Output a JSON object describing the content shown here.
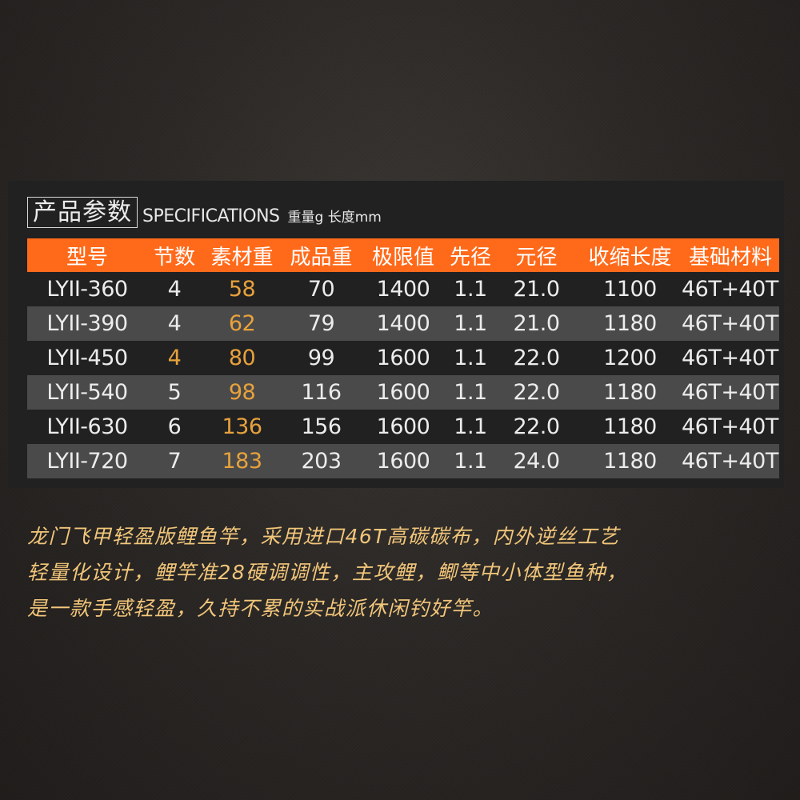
{
  "specs": {
    "title_cn": "产品参数",
    "title_en": "SPECIFICATIONS",
    "units": "重量g 长度mm",
    "headers": [
      "型号",
      "节数",
      "素材重",
      "成品重",
      "极限值",
      "先径",
      "元径",
      "收缩长度",
      "基础材料"
    ],
    "rows": [
      {
        "model": "LYII-360",
        "sections": "4",
        "raw_weight": "58",
        "finished_weight": "70",
        "limit": "1400",
        "tip_dia": "1.1",
        "base_dia": "21.0",
        "retracted_length": "1100",
        "material": "46T+40T"
      },
      {
        "model": "LYII-390",
        "sections": "4",
        "raw_weight": "62",
        "finished_weight": "79",
        "limit": "1400",
        "tip_dia": "1.1",
        "base_dia": "21.0",
        "retracted_length": "1180",
        "material": "46T+40T"
      },
      {
        "model": "LYII-450",
        "sections": "4",
        "raw_weight": "80",
        "finished_weight": "99",
        "limit": "1600",
        "tip_dia": "1.1",
        "base_dia": "22.0",
        "retracted_length": "1200",
        "material": "46T+40T"
      },
      {
        "model": "LYII-540",
        "sections": "5",
        "raw_weight": "98",
        "finished_weight": "116",
        "limit": "1600",
        "tip_dia": "1.1",
        "base_dia": "22.0",
        "retracted_length": "1180",
        "material": "46T+40T"
      },
      {
        "model": "LYII-630",
        "sections": "6",
        "raw_weight": "136",
        "finished_weight": "156",
        "limit": "1600",
        "tip_dia": "1.1",
        "base_dia": "22.0",
        "retracted_length": "1180",
        "material": "46T+40T"
      },
      {
        "model": "LYII-720",
        "sections": "7",
        "raw_weight": "183",
        "finished_weight": "203",
        "limit": "1600",
        "tip_dia": "1.1",
        "base_dia": "24.0",
        "retracted_length": "1180",
        "material": "46T+40T"
      }
    ]
  },
  "description": {
    "lines": [
      "龙门飞甲轻盈版鲤鱼竿，采用进口46T高碳碳布，内外逆丝工艺",
      "轻量化设计，鲤竿准28硬调调性，主攻鲤，鲫等中小体型鱼种，",
      "是一款手感轻盈，久持不累的实战派休闲钓好竿。"
    ]
  },
  "colors": {
    "header_bg": "#ff6a1a",
    "highlight": "#e8a23c",
    "description_text": "#f2c67a",
    "stripe": "#4a4a4a",
    "panel": "#212121"
  }
}
